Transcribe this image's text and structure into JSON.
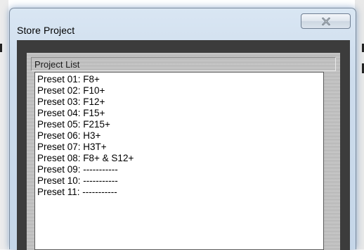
{
  "window": {
    "title": "Store Project",
    "close_icon": "close-icon"
  },
  "project_list": {
    "header": "Project List",
    "items": [
      "Preset 01: F8+",
      "Preset 02: F10+",
      "Preset 03: F12+",
      "Preset 04: F15+",
      "Preset 05: F215+",
      "Preset 06: H3+",
      "Preset 07: H3T+",
      "Preset 08: F8+ & S12+",
      "Preset 09: -----------",
      "Preset 10: -----------",
      "Preset 11: -----------"
    ]
  },
  "colors": {
    "frame_dark": "#3c3c3c",
    "titlebar": "#cddcec",
    "list_bg": "#ffffff"
  }
}
